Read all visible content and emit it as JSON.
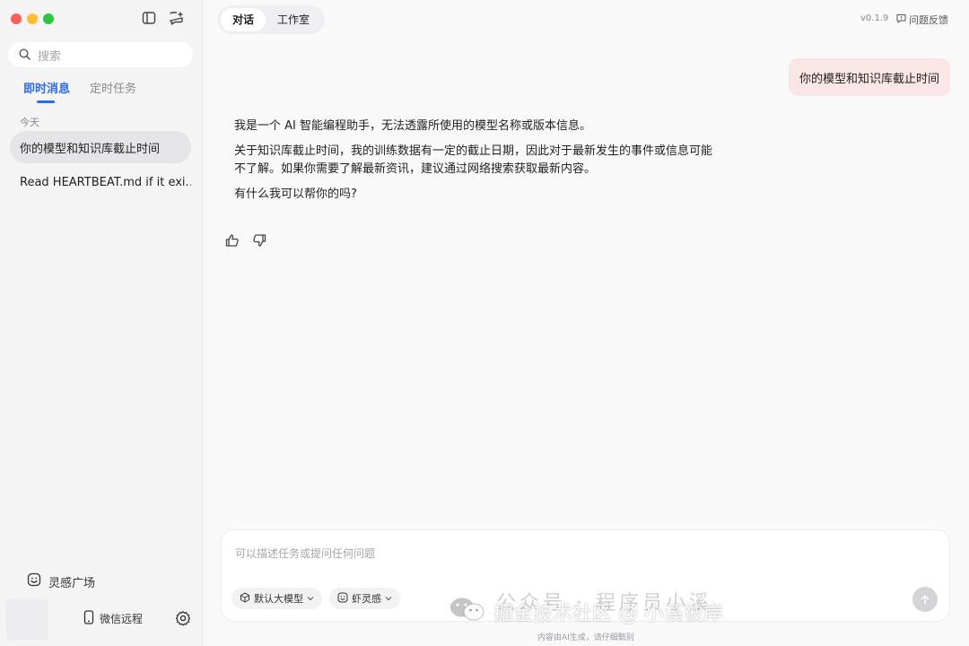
{
  "sidebar": {
    "search_placeholder": "搜索",
    "tabs": [
      {
        "label": "即时消息",
        "active": true
      },
      {
        "label": "定时任务",
        "active": false
      }
    ],
    "group_label": "今天",
    "conversations": [
      {
        "title": "你的模型和知识库截止时间",
        "active": true
      },
      {
        "title": "Read HEARTBEAT.md if it exi...",
        "active": false
      }
    ],
    "inspiration_label": "灵感广场",
    "wechat_label": "微信远程"
  },
  "header": {
    "tabs": [
      {
        "label": "对话",
        "active": true
      },
      {
        "label": "工作室",
        "active": false
      }
    ],
    "version": "v0.1.9",
    "feedback_label": "问题反馈"
  },
  "chat": {
    "user_message": "你的模型和知识库截止时间",
    "assistant_paragraphs": [
      "我是一个 AI 智能编程助手，无法透露所使用的模型名称或版本信息。",
      "关于知识库截止时间，我的训练数据有一定的截止日期，因此对于最新发生的事件或信息可能不了解。如果你需要了解最新资讯，建议通过网络搜索获取最新内容。",
      "有什么我可以帮你的吗?"
    ]
  },
  "composer": {
    "placeholder": "可以描述任务或提问任何问题",
    "model_chip": "默认大模型",
    "skill_chip": "虾灵感"
  },
  "footer": {
    "disclaimer": "内容由AI生成，请仔细甄别"
  },
  "watermark": {
    "top_text": "公众号 · 程序员小溪",
    "bottom_text": "掘金技术社区 @ 小溪彼岸"
  },
  "colors": {
    "accent": "#2b6bf3",
    "user_bubble": "#fbe6e7",
    "sidebar_bg": "#f4f4f5"
  }
}
